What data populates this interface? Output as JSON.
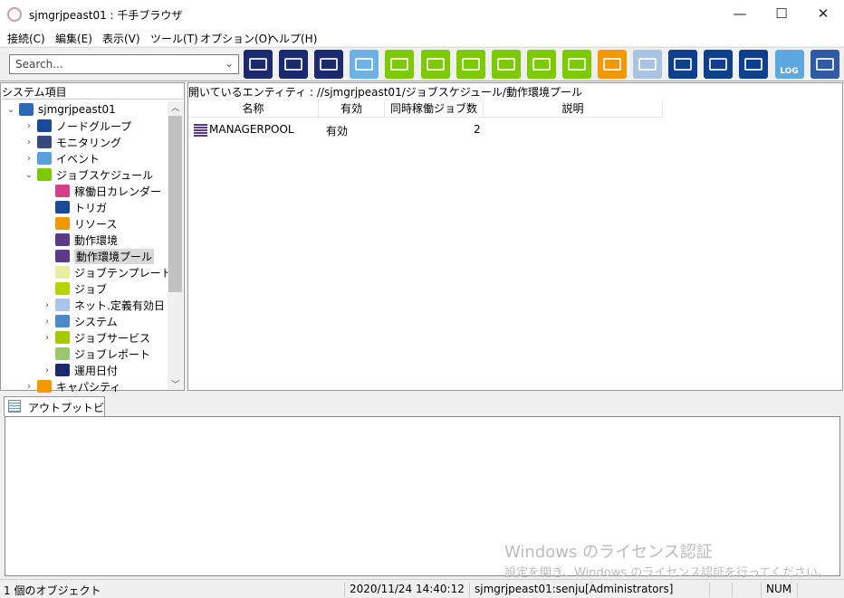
{
  "window": {
    "title": "sjmgrjpeast01 : 千手ブラウザ",
    "minimize": "—",
    "maximize": "☐",
    "close": "✕"
  },
  "menu": [
    "接続(C)",
    "編集(E)",
    "表示(V)",
    "ツール(T)",
    "オプション(O)",
    "ヘルプ(H)"
  ],
  "search": {
    "placeholder": "Search..."
  },
  "toolbar": [
    {
      "name": "node-group-view",
      "color": "#1b2a6e"
    },
    {
      "name": "monitor-view",
      "color": "#1b2a6e"
    },
    {
      "name": "monitor-stack-view",
      "color": "#1b2a6e"
    },
    {
      "name": "message-view",
      "color": "#6cb2e4"
    },
    {
      "name": "job-settings",
      "color": "#7ccb00"
    },
    {
      "name": "job-check",
      "color": "#7ccb00"
    },
    {
      "name": "job-monitor",
      "color": "#7ccb00"
    },
    {
      "name": "screen-check",
      "color": "#7ccb00"
    },
    {
      "name": "job-report-chart",
      "color": "#7ccb00"
    },
    {
      "name": "gantt",
      "color": "#7ccb00"
    },
    {
      "name": "chart-orange",
      "color": "#f39800"
    },
    {
      "name": "capacity",
      "color": "#a9c3e2"
    },
    {
      "name": "export-settings",
      "color": "#0d3f8f"
    },
    {
      "name": "export-check",
      "color": "#0d3f8f"
    },
    {
      "name": "export-monitor",
      "color": "#0d3f8f"
    },
    {
      "name": "log",
      "color": "#5ea8e2",
      "label": "LOG"
    },
    {
      "name": "radar",
      "color": "#2f5aa6"
    }
  ],
  "tree": {
    "header": "システム項目",
    "items": [
      {
        "label": "sjmgrjpeast01",
        "level": 0,
        "exp": "⌄",
        "color": "#2a6ab8"
      },
      {
        "label": "ノードグループ",
        "level": 1,
        "exp": "›",
        "color": "#1b4a9a"
      },
      {
        "label": "モニタリング",
        "level": 1,
        "exp": "›",
        "color": "#3a4a80"
      },
      {
        "label": "イベント",
        "level": 1,
        "exp": "›",
        "color": "#5aa0dc"
      },
      {
        "label": "ジョブスケジュール",
        "level": 1,
        "exp": "⌄",
        "color": "#7ccb00"
      },
      {
        "label": "稼働日カレンダー",
        "level": 2,
        "exp": "",
        "color": "#d6408a"
      },
      {
        "label": "トリガ",
        "level": 2,
        "exp": "",
        "color": "#1b4a9a"
      },
      {
        "label": "リソース",
        "level": 2,
        "exp": "",
        "color": "#f39800"
      },
      {
        "label": "動作環境",
        "level": 2,
        "exp": "",
        "color": "#5b3a8a"
      },
      {
        "label": "動作環境プール",
        "level": 2,
        "exp": "",
        "color": "#5b3a8a",
        "selected": true
      },
      {
        "label": "ジョブテンプレート",
        "level": 2,
        "exp": "",
        "color": "#e6f0a0"
      },
      {
        "label": "ジョブ",
        "level": 2,
        "exp": "",
        "color": "#b8d400"
      },
      {
        "label": "ネット.定義有効日",
        "level": 2,
        "exp": "›",
        "color": "#a8c4ec"
      },
      {
        "label": "システム",
        "level": 2,
        "exp": "›",
        "color": "#4a8ac8"
      },
      {
        "label": "ジョブサービス",
        "level": 2,
        "exp": "›",
        "color": "#a8c800"
      },
      {
        "label": "ジョブレポート",
        "level": 2,
        "exp": "",
        "color": "#9ac870"
      },
      {
        "label": "運用日付",
        "level": 2,
        "exp": "›",
        "color": "#1b2a6e"
      },
      {
        "label": "キャパシティ",
        "level": 1,
        "exp": "›",
        "color": "#f39800"
      }
    ]
  },
  "main": {
    "path": "開いているエンティティ : //sjmgrjpeast01/ジョブスケジュール/動作環境プール",
    "columns": [
      "名称",
      "有効",
      "同時稼働ジョブ数",
      "説明"
    ],
    "rows": [
      {
        "name": "MANAGERPOOL",
        "enabled": "有効",
        "jobs": "2",
        "desc": ""
      }
    ]
  },
  "output": {
    "tab": "アウトプットビュー"
  },
  "watermark": {
    "line1": "Windows のライセンス認証",
    "line2": "設定を開き、Windows のライセンス認証を行ってください。"
  },
  "status": {
    "objects": "1 個のオブジェクト",
    "datetime": "2020/11/24 14:40:12",
    "user": "sjmgrjpeast01:senju[Administrators]",
    "num": "NUM"
  }
}
